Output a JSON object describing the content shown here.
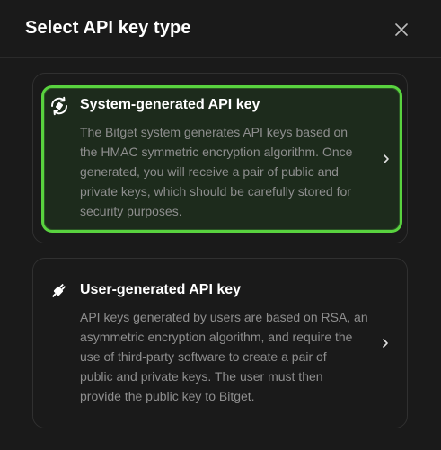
{
  "dialog": {
    "title": "Select API key type",
    "close_icon": "close-icon"
  },
  "options": [
    {
      "icon": "key-rotate-icon",
      "title": "System-generated API key",
      "description": "The Bitget system generates API keys based on\nthe HMAC symmetric encryption algorithm. Once\ngenerated, you will receive a pair of public and\nprivate keys, which should be carefully stored for\nsecurity purposes.",
      "selected": true,
      "chevron_icon": "chevron-right-icon"
    },
    {
      "icon": "plug-icon",
      "title": "User-generated API key",
      "description": "API keys generated by users are based on RSA, an\nasymmetric encryption algorithm, and require the\nuse of third-party software to create a pair of\npublic and private keys. The user must then\nprovide the public key to Bitget.",
      "selected": false,
      "chevron_icon": "chevron-right-icon"
    }
  ],
  "colors": {
    "accent": "#59d23f",
    "background": "#1a1a1a",
    "selected_background": "#1d2b1c",
    "text_primary": "#ffffff",
    "text_secondary": "#8e8e8e"
  }
}
